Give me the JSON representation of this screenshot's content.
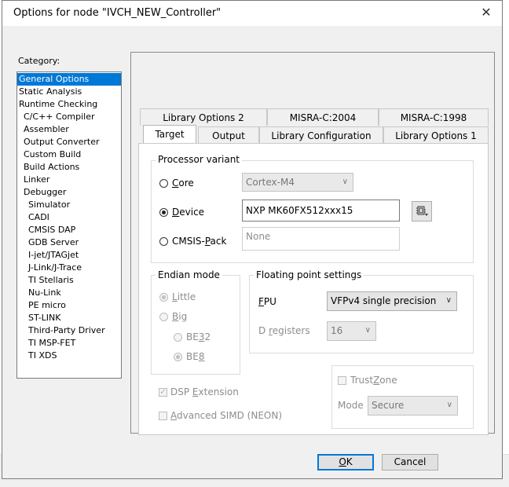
{
  "dialog": {
    "title": "Options for node \"IVCH_NEW_Controller\"",
    "close_glyph": "✕"
  },
  "category": {
    "label": "Category:",
    "items": [
      {
        "label": "General Options",
        "level": 0,
        "selected": true
      },
      {
        "label": "Static Analysis",
        "level": 0
      },
      {
        "label": "Runtime Checking",
        "level": 0
      },
      {
        "label": "C/C++ Compiler",
        "level": 1
      },
      {
        "label": "Assembler",
        "level": 1
      },
      {
        "label": "Output Converter",
        "level": 1
      },
      {
        "label": "Custom Build",
        "level": 1
      },
      {
        "label": "Build Actions",
        "level": 1
      },
      {
        "label": "Linker",
        "level": 1
      },
      {
        "label": "Debugger",
        "level": 1
      },
      {
        "label": "Simulator",
        "level": 2
      },
      {
        "label": "CADI",
        "level": 2
      },
      {
        "label": "CMSIS DAP",
        "level": 2
      },
      {
        "label": "GDB Server",
        "level": 2
      },
      {
        "label": "I-jet/JTAGjet",
        "level": 2
      },
      {
        "label": "J-Link/J-Trace",
        "level": 2
      },
      {
        "label": "TI Stellaris",
        "level": 2
      },
      {
        "label": "Nu-Link",
        "level": 2
      },
      {
        "label": "PE micro",
        "level": 2
      },
      {
        "label": "ST-LINK",
        "level": 2
      },
      {
        "label": "Third-Party Driver",
        "level": 2
      },
      {
        "label": "TI MSP-FET",
        "level": 2
      },
      {
        "label": "TI XDS",
        "level": 2
      }
    ]
  },
  "tabs": {
    "row_back": [
      "Library Options 2",
      "MISRA-C:2004",
      "MISRA-C:1998"
    ],
    "row_front": [
      "Target",
      "Output",
      "Library Configuration",
      "Library Options 1"
    ],
    "active": "Target"
  },
  "processor": {
    "group_title": "Processor variant",
    "core": {
      "label_pre": "",
      "label_u": "C",
      "label_post": "ore",
      "value": "Cortex-M4"
    },
    "device": {
      "label_pre": "",
      "label_u": "D",
      "label_post": "evice",
      "value": "NXP MK60FX512xxx15",
      "selected": true
    },
    "cmsis": {
      "label_pre": "CMSIS-",
      "label_u": "P",
      "label_post": "ack",
      "value": "None"
    }
  },
  "endian": {
    "group_title": "Endian mode",
    "little": {
      "label_pre": "",
      "label_u": "L",
      "label_post": "ittle",
      "selected": true
    },
    "big": {
      "label_pre": "",
      "label_u": "B",
      "label_post": "ig"
    },
    "be32": {
      "label_pre": "BE",
      "label_u": "3",
      "label_post": "2"
    },
    "be8": {
      "label_pre": "BE",
      "label_u": "8",
      "label_post": "",
      "selected": true
    }
  },
  "fpu": {
    "group_title": "Floating point settings",
    "fpu_label_u": "F",
    "fpu_label_post": "PU",
    "fpu_value": "VFPv4 single precision",
    "dreg_label_pre": "D ",
    "dreg_label_u": "r",
    "dreg_label_post": "egisters",
    "dreg_value": "16"
  },
  "dsp": {
    "label_pre": "DSP ",
    "label_u": "E",
    "label_post": "xtension",
    "checked": true
  },
  "simd": {
    "label_pre": "",
    "label_u": "A",
    "label_post": "dvanced SIMD (NEON)",
    "checked": false
  },
  "trustzone": {
    "label_pre": "Trust",
    "label_u": "Z",
    "label_post": "one",
    "mode_label": "Mode",
    "mode_value": "Secure"
  },
  "buttons": {
    "ok_u": "O",
    "ok_post": "K",
    "cancel": "Cancel"
  },
  "icons": {
    "dropdown": "∨",
    "check": "✓"
  }
}
